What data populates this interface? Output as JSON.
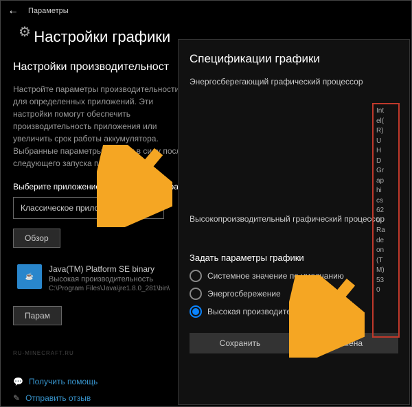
{
  "header": {
    "title": "Параметры"
  },
  "page": {
    "title": "Настройки графики"
  },
  "section": {
    "subtitle": "Настройки производительност",
    "description": "Настройте параметры производительности для определенных приложений. Эти настройки помогут обеспечить производительность приложения или увеличить срок работы аккумулятора. Выбранные параметры вступят в силу после следующего запуска приложения.",
    "select_label": "Выберите приложение для настройки парам",
    "dropdown_value": "Классическое приложение",
    "browse": "Обзор",
    "options": "Парам"
  },
  "app": {
    "name": "Java(TM) Platform SE binary",
    "perf": "Высокая производительность",
    "path": "C:\\Program Files\\Java\\jre1.8.0_281\\bin\\"
  },
  "footer": {
    "help": "Получить помощь",
    "feedback": "Отправить отзыв"
  },
  "dialog": {
    "title": "Спецификации графики",
    "power_saving": "Энергосберегающий графический процессор",
    "high_perf": "Высокопроизводительный графический процессор",
    "gpu1": "Intel(R) UHD Graphics 620",
    "gpu2": "Radeon(TM) 530",
    "settings_label": "Задать параметры графики",
    "radio": {
      "default": "Системное значение по умолчанию",
      "power": "Энергосбережение",
      "perf": "Высокая производительность"
    },
    "save": "Сохранить",
    "cancel": "Отмена"
  },
  "watermark": "RU-MINECRAFT.RU"
}
